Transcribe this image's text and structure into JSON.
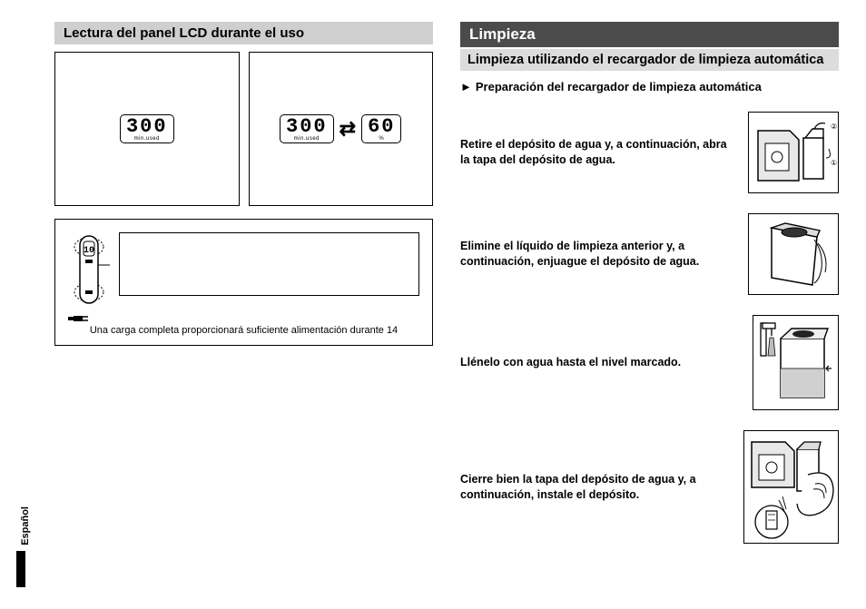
{
  "left": {
    "heading": "Lectura del panel LCD durante el uso",
    "lcd1": {
      "value": "300",
      "unit": "min.used"
    },
    "lcd2a": {
      "value": "300",
      "unit": "min.used"
    },
    "lcd2b": {
      "value": "60",
      "unit": "%"
    },
    "charge": {
      "shaver_value": "10",
      "caption": "Una carga completa proporcionará suficiente alimentación durante 14"
    }
  },
  "right": {
    "heading": "Limpieza",
    "subheading": "Limpieza utilizando el recargador de limpieza automática",
    "prep": "Preparación del recargador de limpieza automática",
    "steps": [
      {
        "text": "Retire el depósito de agua y, a continuación, abra la tapa del depósito de agua."
      },
      {
        "text": "Elimine el líquido de limpieza anterior y, a continuación, enjuague el depósito de agua."
      },
      {
        "text": "Llénelo con agua hasta el nivel marcado."
      },
      {
        "text": "Cierre bien la tapa del depósito de agua y, a continuación, instale el depósito."
      }
    ]
  },
  "language_tab": "Español"
}
